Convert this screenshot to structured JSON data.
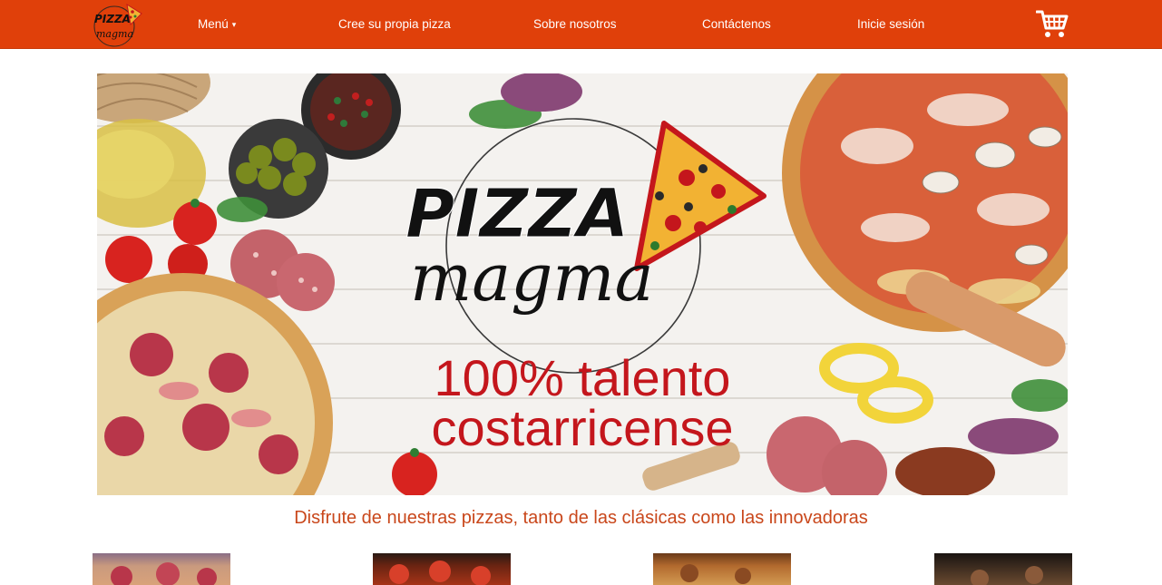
{
  "nav": {
    "logo_text_top": "PIZZA",
    "logo_text_bottom": "magma",
    "menu_label": "Menú",
    "menu_caret": "▾",
    "build_label": "Cree su propia pizza",
    "about_label": "Sobre nosotros",
    "contact_label": "Contáctenos",
    "login_label": "Inicie sesión",
    "cart_icon": "cart-icon"
  },
  "hero": {
    "brand_top": "PIZZA",
    "brand_bottom": "magma",
    "slogan_line1": "100% talento",
    "slogan_line2": "costarricense"
  },
  "tagline": "Disfrute de nuestras pizzas, tanto de las clásicas como las innovadoras",
  "colors": {
    "nav_bg": "#e0400a",
    "tagline": "#c9471b",
    "slogan": "#c4161c"
  },
  "products": [
    {
      "name": "pizza-photo-1"
    },
    {
      "name": "pizza-photo-2"
    },
    {
      "name": "pizza-photo-3"
    },
    {
      "name": "pizza-photo-4"
    }
  ]
}
